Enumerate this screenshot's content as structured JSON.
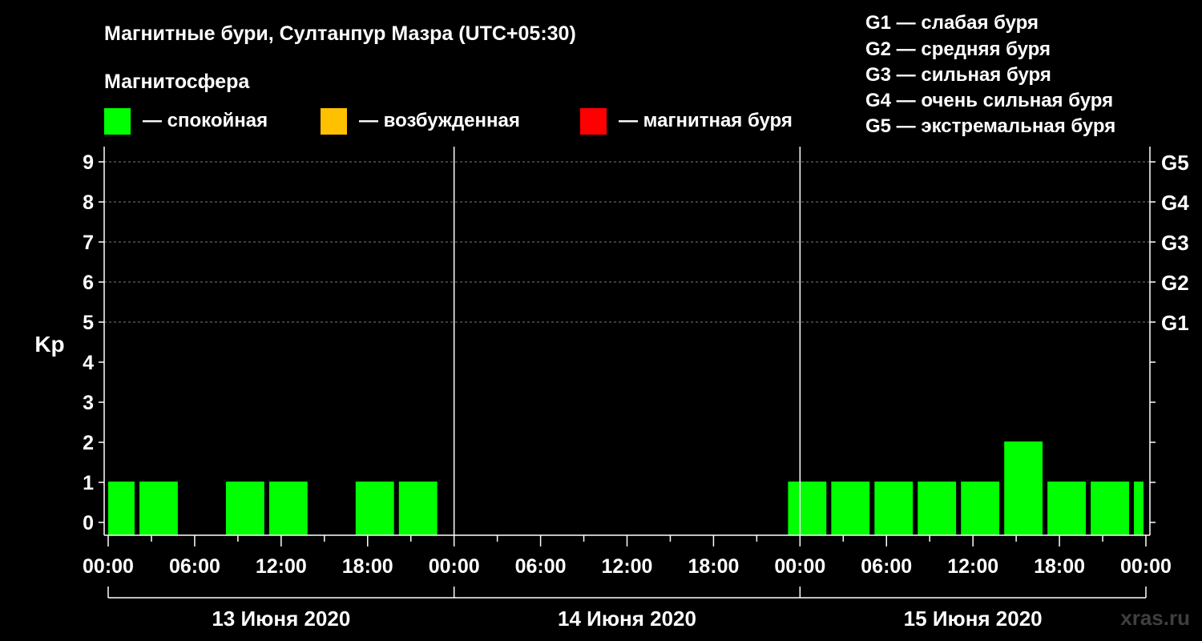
{
  "title": "Магнитные бури, Султанпур Мазра (UTC+05:30)",
  "legend": {
    "heading": "Магнитосфера",
    "items": [
      {
        "label": "— спокойная",
        "color": "#00ff00"
      },
      {
        "label": "— возбужденная",
        "color": "#ffc000"
      },
      {
        "label": "— магнитная буря",
        "color": "#ff0000"
      }
    ]
  },
  "g_scale": [
    "G1 — слабая буря",
    "G2 — средняя буря",
    "G3 — сильная буря",
    "G4 — очень сильная буря",
    "G5 — экстремальная буря"
  ],
  "watermark": "xras.ru",
  "chart_data": {
    "type": "bar",
    "ylabel": "Kp",
    "ylim": [
      0,
      9
    ],
    "y_ticks": [
      0,
      1,
      2,
      3,
      4,
      5,
      6,
      7,
      8,
      9
    ],
    "right_ticks": [
      {
        "value": 5,
        "label": "G1"
      },
      {
        "value": 6,
        "label": "G2"
      },
      {
        "value": 7,
        "label": "G3"
      },
      {
        "value": 8,
        "label": "G4"
      },
      {
        "value": 9,
        "label": "G5"
      }
    ],
    "x_hours_range": [
      0,
      72
    ],
    "x_tick_labels": [
      "00:00",
      "06:00",
      "12:00",
      "18:00",
      "00:00",
      "06:00",
      "12:00",
      "18:00",
      "00:00",
      "06:00",
      "12:00",
      "18:00",
      "00:00"
    ],
    "days": [
      "13 Июня 2020",
      "14 Июня 2020",
      "15 Июня 2020"
    ],
    "bar_color": "#00ff00",
    "bars": [
      {
        "start_hour": 0,
        "end_hour": 1.83,
        "kp": 1
      },
      {
        "start_hour": 2.17,
        "end_hour": 4.83,
        "kp": 1
      },
      {
        "start_hour": 8.17,
        "end_hour": 10.83,
        "kp": 1
      },
      {
        "start_hour": 11.17,
        "end_hour": 13.83,
        "kp": 1
      },
      {
        "start_hour": 17.17,
        "end_hour": 19.83,
        "kp": 1
      },
      {
        "start_hour": 20.17,
        "end_hour": 22.83,
        "kp": 1
      },
      {
        "start_hour": 47.17,
        "end_hour": 49.83,
        "kp": 1
      },
      {
        "start_hour": 50.17,
        "end_hour": 52.83,
        "kp": 1
      },
      {
        "start_hour": 53.17,
        "end_hour": 55.83,
        "kp": 1
      },
      {
        "start_hour": 56.17,
        "end_hour": 58.83,
        "kp": 1
      },
      {
        "start_hour": 59.17,
        "end_hour": 61.83,
        "kp": 1
      },
      {
        "start_hour": 62.17,
        "end_hour": 64.83,
        "kp": 2
      },
      {
        "start_hour": 65.17,
        "end_hour": 67.83,
        "kp": 1
      },
      {
        "start_hour": 68.17,
        "end_hour": 70.83,
        "kp": 1
      },
      {
        "start_hour": 71.17,
        "end_hour": 71.83,
        "kp": 1
      }
    ]
  }
}
